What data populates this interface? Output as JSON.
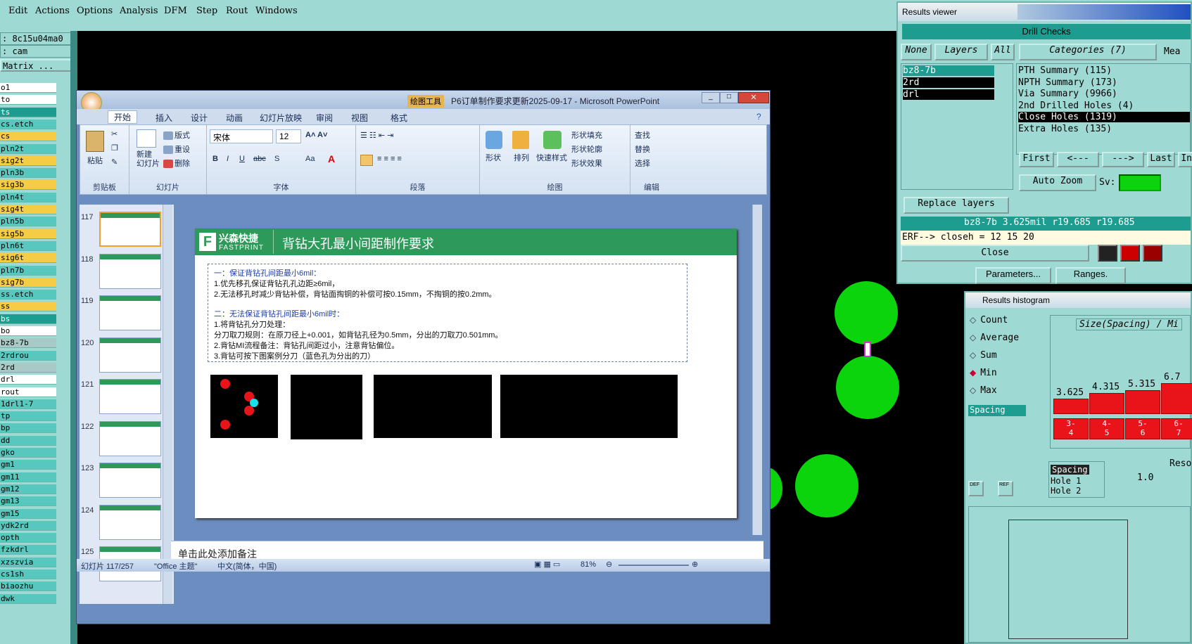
{
  "menubar": {
    "items": [
      "Edit",
      "Actions",
      "Options",
      "Analysis",
      "DFM",
      "Step",
      "Rout",
      "Windows"
    ]
  },
  "left": {
    "job": ": 8c15u04ma0",
    "user": ": cam",
    "matrix_btn": "Matrix ...",
    "layers": [
      "o1",
      "to",
      "ts",
      "cs.etch",
      "cs",
      "pln2t",
      "sig2t",
      "pln3b",
      "sig3b",
      "pln4t",
      "sig4t",
      "pln5b",
      "sig5b",
      "pln6t",
      "sig6t",
      "pln7b",
      "sig7b",
      "ss.etch",
      "ss",
      "bs",
      "bo",
      "bz8-7b",
      "2rdrou",
      "2rd",
      "drl",
      "rout",
      "1drl1-7",
      "tp",
      "bp",
      "dd",
      "gko",
      "gm1",
      "gm11",
      "gm12",
      "gm13",
      "gm15",
      "ydk2rd",
      "opth",
      "fzkdrl",
      "xzszvia",
      "cs1sh",
      "biaozhu",
      "dwk"
    ]
  },
  "ppt": {
    "drawing_tools": "绘图工具",
    "title": "P6订单制作要求更新2025-09-17 - Microsoft PowerPoint",
    "tabs": [
      "开始",
      "插入",
      "设计",
      "动画",
      "幻灯片放映",
      "审阅",
      "视图",
      "格式"
    ],
    "groups": {
      "clipboard": "剪贴板",
      "slides": "幻灯片",
      "font": "字体",
      "paragraph": "段落",
      "drawing": "绘图",
      "edit": "编辑"
    },
    "buttons": {
      "paste": "粘贴",
      "new_slide": "新建\n幻灯片",
      "layout": "版式",
      "reset": "重设",
      "delete": "删除",
      "shape": "形状",
      "arrange": "排列",
      "quick_style": "快速样式",
      "shape_fill": "形状填充",
      "shape_outline": "形状轮廓",
      "shape_effect": "形状效果",
      "find": "查找",
      "replace": "替换",
      "select": "选择"
    },
    "font_name": "宋体",
    "font_size": "12",
    "slide_numbers": [
      "117",
      "118",
      "119",
      "120",
      "121",
      "122",
      "123",
      "124",
      "125"
    ],
    "slide": {
      "logo_cn": "兴森快捷",
      "logo_en": "FASTPRINT",
      "title": "背钻大孔最小间距制作要求",
      "lines": [
        "一：保证背钻孔间距最小6mil：",
        "1.优先移孔保证背钻孔孔边距≥6mil，",
        "2.无法移孔时减少背钻补偿，背钻面掏铜的补偿可按0.15mm，不掏铜的按0.2mm。",
        "二：无法保证背钻孔间距最小6mil时：",
        "1.将背钻孔分刀处理：",
        "分刀取刀规则：在原刀径上+0.001，如背钻孔径为0.5mm，分出的刀取刀0.501mm。",
        "2.背钻MI流程备注：背钻孔间距过小，注意背钻偏位。",
        "3.背钻可按下图案例分刀（蓝色孔为分出的刀）"
      ]
    },
    "notes": "单击此处添加备注",
    "status": {
      "slide": "幻灯片 117/257",
      "theme": "\"Office 主题\"",
      "lang": "中文(简体，中国)",
      "zoom": "81%"
    }
  },
  "results": {
    "title": "Results viewer",
    "section": "Drill Checks",
    "none": "None",
    "layers": "Layers",
    "all": "All",
    "categories": "Categories (7)",
    "mea": "Mea",
    "layer_list": [
      "bz8-7b",
      "2rd",
      "drl"
    ],
    "cat_list": [
      "PTH Summary (115)",
      "NPTH Summary (173)",
      "Via Summary (9966)",
      "2nd Drilled Holes (4)",
      "Close Holes (1319)",
      "Extra Holes (135)"
    ],
    "nav": [
      "First",
      "<---",
      "--->",
      "Last",
      "Inde"
    ],
    "auto_zoom": "Auto Zoom",
    "sv": "Sv:",
    "replace_layers": "Replace layers",
    "info": "bz8-7b 3.625mil  r19.685  r19.685",
    "erf": "ERF--> closeh = 12 15 20",
    "close": "Close",
    "params": "Parameters...",
    "ranges": "Ranges."
  },
  "hist": {
    "title": "Results histogram",
    "opts": [
      "Count",
      "Average",
      "Sum",
      "Min",
      "Max"
    ],
    "selected": "Min",
    "field": "Size(Spacing) / Mi",
    "spacing": "Spacing",
    "bar_values": [
      "3.625",
      "4.315",
      "5.315",
      "6.7"
    ],
    "bins": [
      "3-\n4",
      "4-\n5",
      "5-\n6",
      "6-\n7"
    ],
    "res": "Reso",
    "res_val": "1.0",
    "holes": [
      "Hole 1",
      "Hole 2"
    ],
    "def": "DEF",
    "ref": "REF"
  },
  "colors": {
    "teal": "#9ed9d4",
    "green": "#0cd40c",
    "red": "#e8141a",
    "cyan": "#19e0e8"
  }
}
